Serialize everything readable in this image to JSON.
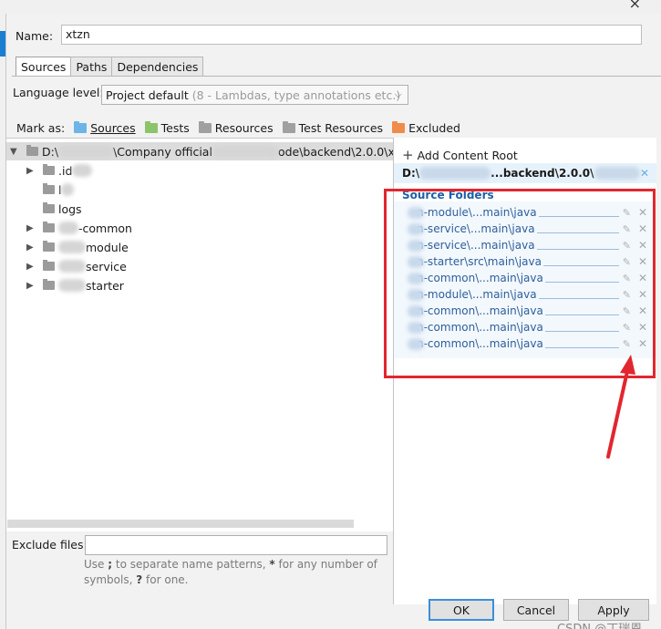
{
  "dialog": {
    "name_label": "Name:",
    "name_value": "xtzn",
    "tabs": [
      {
        "label": "Sources",
        "active": true
      },
      {
        "label": "Paths",
        "active": false
      },
      {
        "label": "Dependencies",
        "active": false
      }
    ],
    "language_level_label": "Language level:",
    "language_level_value": "Project default",
    "language_level_hint": "(8 - Lambdas, type annotations etc.)",
    "mark_as_label": "Mark as:",
    "mark_as": [
      {
        "label": "Sources",
        "icon": "sources-folder-icon",
        "color": "#6db5e6"
      },
      {
        "label": "Tests",
        "icon": "tests-folder-icon",
        "color": "#8cc46a"
      },
      {
        "label": "Resources",
        "icon": "resources-folder-icon",
        "color": "#a0a0a0"
      },
      {
        "label": "Test Resources",
        "icon": "test-resources-folder-icon",
        "color": "#a0a0a0"
      },
      {
        "label": "Excluded",
        "icon": "excluded-folder-icon",
        "color": "#f08c4a"
      }
    ]
  },
  "tree": {
    "root": {
      "prefix": "D:\\",
      "mid": "\\Company official",
      "suffix": "ode\\backend\\2.0.0\\x"
    },
    "items": [
      {
        "label": ".id",
        "expandable": true
      },
      {
        "label": "l",
        "expandable": false
      },
      {
        "label": "logs",
        "expandable": false
      },
      {
        "label": "-common",
        "expandable": true
      },
      {
        "label": "module",
        "expandable": true
      },
      {
        "label": "service",
        "expandable": true
      },
      {
        "label": "starter",
        "expandable": true
      }
    ]
  },
  "exclude": {
    "label": "Exclude files:",
    "value": "",
    "hint_1": "Use",
    "hint_sep": ";",
    "hint_2": "to separate name patterns,",
    "hint_star": "*",
    "hint_3": "for any number of symbols,",
    "hint_q": "?",
    "hint_4": "for one."
  },
  "content_root": {
    "add_label": "Add Content Root",
    "path_prefix": "D:\\",
    "path_suffix": "...backend\\2.0.0\\",
    "source_folders_title": "Source Folders",
    "source_folders": [
      "n-module\\...main\\java",
      "n-service\\...main\\java",
      "n-service\\...main\\java",
      "n-starter\\src\\main\\java",
      "n-common\\...main\\java",
      "n-module\\...main\\java",
      "n-common\\...main\\java",
      "n-common\\...main\\java",
      "n-common\\...main\\java"
    ]
  },
  "buttons": {
    "ok": "OK",
    "cancel": "Cancel",
    "apply": "Apply"
  },
  "watermark": "CSDN @丁瑞恩",
  "colors": {
    "accent": "#1a7fd0",
    "highlight_box": "#e2262f",
    "source_folder_text": "#2d5f9c"
  }
}
